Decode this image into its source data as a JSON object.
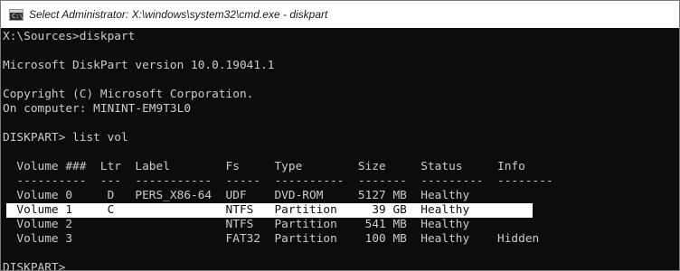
{
  "window": {
    "title": "Select Administrator: X:\\windows\\system32\\cmd.exe - diskpart",
    "icon": "cmd-console-icon"
  },
  "console": {
    "lines": [
      "X:\\Sources>diskpart",
      "",
      "Microsoft DiskPart version 10.0.19041.1",
      "",
      "Copyright (C) Microsoft Corporation.",
      "On computer: MININT-EM9T3L0",
      "",
      "DISKPART> list vol",
      "",
      "  Volume ###  Ltr  Label        Fs     Type        Size     Status     Info",
      "  ----------  ---  -----------  -----  ----------  -------  ---------  --------",
      "  Volume 0     D   PERS_X86-64  UDF    DVD-ROM     5127 MB  Healthy",
      "  Volume 1     C                NTFS   Partition     39 GB  Healthy",
      "  Volume 2                      NTFS   Partition    541 MB  Healthy",
      "  Volume 3                      FAT32  Partition    100 MB  Healthy    Hidden",
      "",
      "DISKPART> "
    ],
    "selected_line_index": 12,
    "prompt_line_index": 16,
    "text_color": "#cccccc",
    "background_color": "#0c0c0c",
    "selection_color": "#ffffff"
  }
}
